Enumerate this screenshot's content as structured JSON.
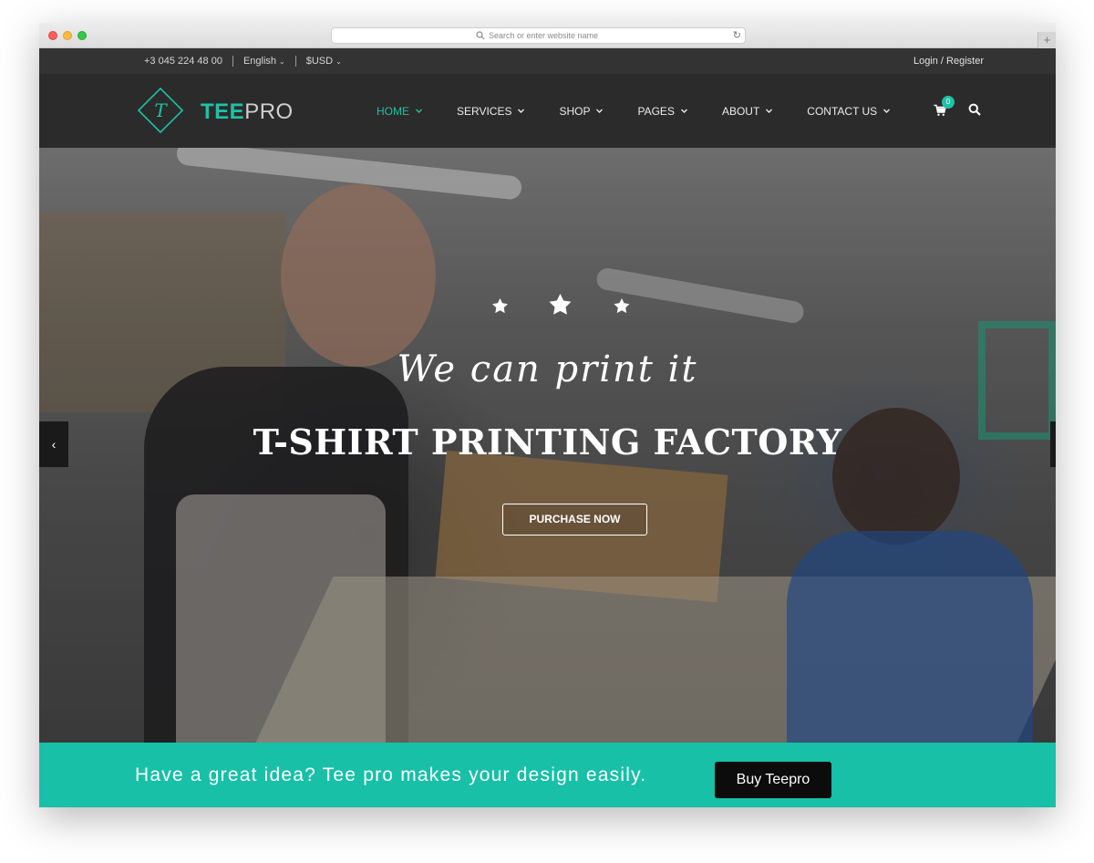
{
  "browser": {
    "url_placeholder": "Search or enter website name",
    "new_tab_label": "+"
  },
  "topbar": {
    "phone": "+3 045 224 48 00",
    "language": "English",
    "currency": "$USD",
    "login": "Login / Register"
  },
  "header": {
    "logo_mark_letter": "T",
    "logo_tee": "TEE",
    "logo_pro": "PRO",
    "nav": [
      {
        "label": "HOME",
        "active": true
      },
      {
        "label": "SERVICES",
        "active": false
      },
      {
        "label": "SHOP",
        "active": false
      },
      {
        "label": "PAGES",
        "active": false
      },
      {
        "label": "ABOUT",
        "active": false
      },
      {
        "label": "CONTACT US",
        "active": false
      }
    ],
    "cart_count": "0",
    "cart_icon": "cart-icon",
    "search_icon": "search-icon"
  },
  "hero": {
    "script_line": "We can print it",
    "title": "T-SHIRT PRINTING FACTORY",
    "button_label": "PURCHASE NOW",
    "prev_arrow": "‹",
    "star_count": 3
  },
  "cta": {
    "text": "Have a great idea? Tee pro makes your design easily.",
    "button_label": "Buy Teepro"
  },
  "colors": {
    "accent": "#1ec2a6",
    "banner": "#17c0a7",
    "header_bg": "#2b2b2b",
    "topbar_bg": "#333333",
    "button_dark": "#0c0c0c"
  }
}
